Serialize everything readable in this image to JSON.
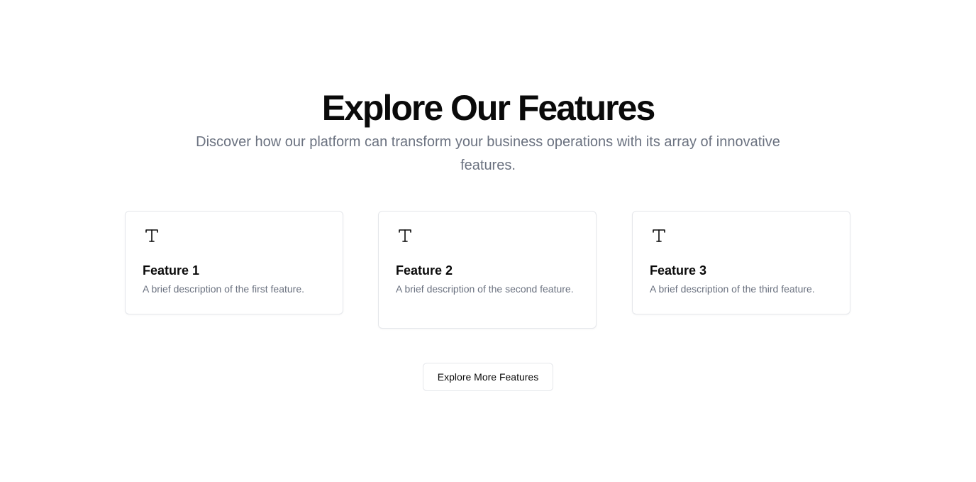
{
  "hero": {
    "title": "Explore Our Features",
    "subtitle": "Discover how our platform can transform your business operations with its array of innovative features."
  },
  "features": [
    {
      "icon": "type-icon",
      "title": "Feature 1",
      "description": "A brief description of the first feature."
    },
    {
      "icon": "type-icon",
      "title": "Feature 2",
      "description": "A brief description of the second feature."
    },
    {
      "icon": "type-icon",
      "title": "Feature 3",
      "description": "A brief description of the third feature."
    }
  ],
  "cta": {
    "label": "Explore More Features"
  },
  "colors": {
    "text": "#0a0a0a",
    "muted": "#6b7280",
    "border": "#e5e7eb",
    "background": "#ffffff"
  }
}
